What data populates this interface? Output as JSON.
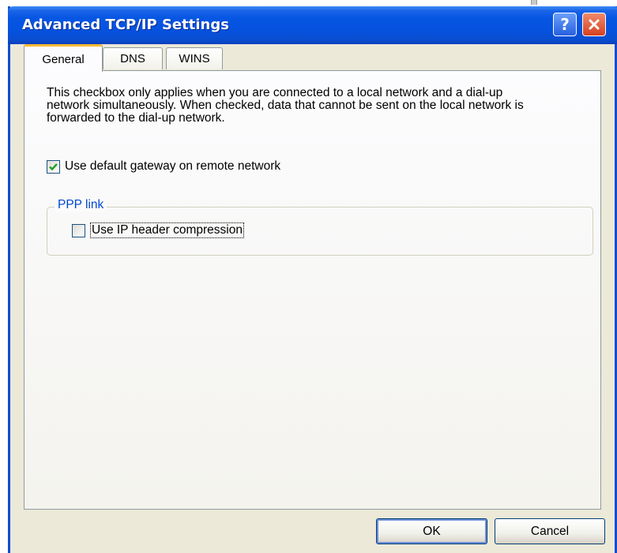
{
  "window": {
    "title": "Advanced TCP/IP Settings"
  },
  "titlebar": {
    "help_label": "?"
  },
  "tabs": [
    {
      "label": "General",
      "active": true
    },
    {
      "label": "DNS",
      "active": false
    },
    {
      "label": "WINS",
      "active": false
    }
  ],
  "general": {
    "description": "This checkbox only applies when you are connected to a local network and a dial-up network simultaneously.  When checked, data that cannot be sent on the local network is forwarded to the dial-up network.",
    "gateway_checkbox": {
      "label": "Use default gateway on remote network",
      "checked": true
    },
    "ppp_group": {
      "title": "PPP link",
      "ip_compression_checkbox": {
        "label": "Use IP header compression",
        "checked": false
      }
    }
  },
  "buttons": {
    "ok": "OK",
    "cancel": "Cancel"
  }
}
